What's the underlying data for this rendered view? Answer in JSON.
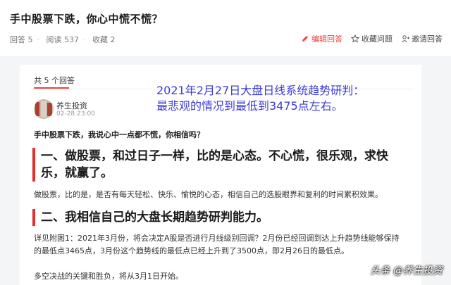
{
  "question": {
    "title": "手中股票下跌，你心中慌不慌？",
    "answers_label": "回答 5",
    "reads_label": "阅读 537",
    "favorites_label": "收藏 2",
    "actions": {
      "edit": "编辑回答",
      "favorite": "收藏问题",
      "invite": "邀请回答"
    }
  },
  "answers": {
    "count_label": "共 5 个回答"
  },
  "overlay": {
    "line1": "2021年2月27日大盘日线系统趋势研判：",
    "line2": "最悲观的情况到最低到3475点左右。"
  },
  "answer": {
    "author": "养生投资",
    "date": "02-28 23:00",
    "lead": "手中股票下跌，我说心中一点都不慌，你相信吗？",
    "heading1": "一、做股票，和过日子一样，比的是心态。不心慌，很乐观，求快乐，就赢了。",
    "para1": "做股票，比的是，是否有每天轻松、快乐、愉悦的心态，相信自己的选股眼界和复利的时间累积效果。",
    "heading2": "二、我相信自己的大盘长期趋势研判能力。",
    "para2": "详见附图1：2021年3月份，将会决定A股是否进行月线级别回调？2月份已经回调到达上升趋势线能够保持的最低点3465点，3月份这个趋势线的最低点已经上升到了3500点，即2月26日的最低点。",
    "para3": "多空决战的关键和胜负，将从3月1日开始。"
  },
  "watermark": "头条 @养生投资",
  "colors": {
    "accent": "#f04142",
    "overlay_text": "#3b3bd9",
    "heading_bar": "#e0312f"
  }
}
